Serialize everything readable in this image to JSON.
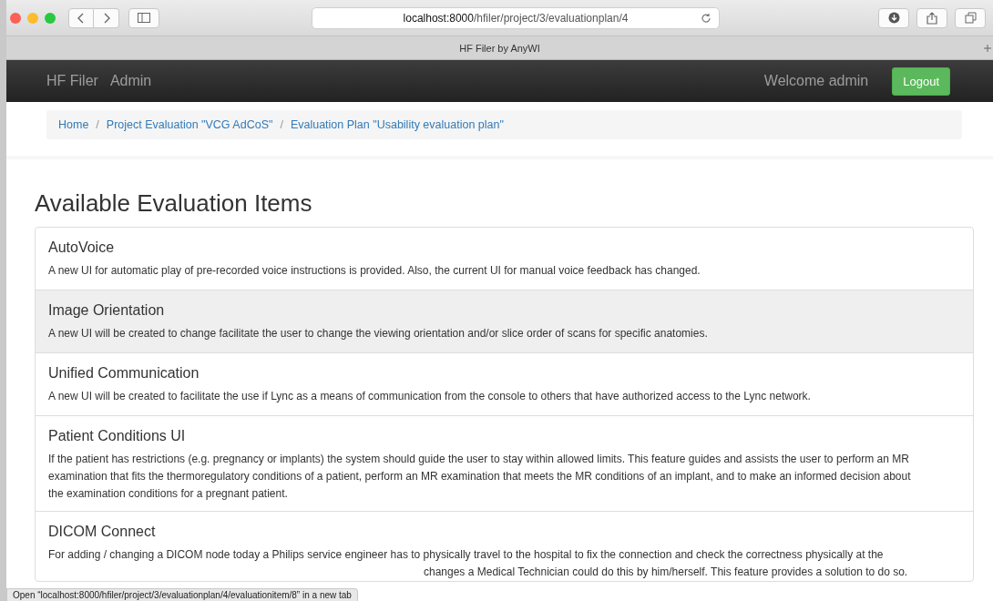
{
  "browser": {
    "url_host": "localhost:8000",
    "url_path": "/hfiler/project/3/evaluationplan/4",
    "tab_title": "HF Filer by AnyWI"
  },
  "navbar": {
    "brand": "HF Filer",
    "links": [
      "Admin"
    ],
    "welcome": "Welcome admin",
    "logout": "Logout"
  },
  "breadcrumb_separator": "/",
  "breadcrumb": [
    "Home",
    "Project Evaluation \"VCG AdCoS\"",
    "Evaluation Plan \"Usability evaluation plan\""
  ],
  "heading": "Available Evaluation Items",
  "items": [
    {
      "title": "AutoVoice",
      "description": "A new UI for automatic play of pre-recorded voice instructions is provided. Also, the current UI for manual voice feedback has changed.",
      "hovered": false
    },
    {
      "title": "Image Orientation",
      "description": "A new UI will be created to change facilitate the user to change the viewing orientation and/or slice order of scans for specific anatomies.",
      "hovered": true
    },
    {
      "title": "Unified Communication",
      "description": "A new UI will be created to facilitate the use if Lync as a means of communication from the console to others that have authorized access to the Lync network.",
      "hovered": false
    },
    {
      "title": "Patient Conditions UI",
      "description": "If the patient has restrictions (e.g. pregnancy or implants) the system should guide the user to stay within allowed limits. This feature guides and assists the user to perform an MR examination that fits the thermoregulatory conditions of a patient, perform an MR examination that meets the MR conditions of an implant, and to make an informed decision about the examination conditions for a pregnant patient.",
      "hovered": false
    },
    {
      "title": "DICOM Connect",
      "description": "For adding / changing a DICOM node today a Philips service engineer has to physically travel to the hospital to fix the connection and check the correctness physically at the",
      "description_tail": "changes a Medical Technician could do this by him/herself. This feature provides a solution to do so.",
      "hovered": false
    }
  ],
  "status_bar": "Open “localhost:8000/hfiler/project/3/evaluationplan/4/evaluationitem/8” in a new tab"
}
